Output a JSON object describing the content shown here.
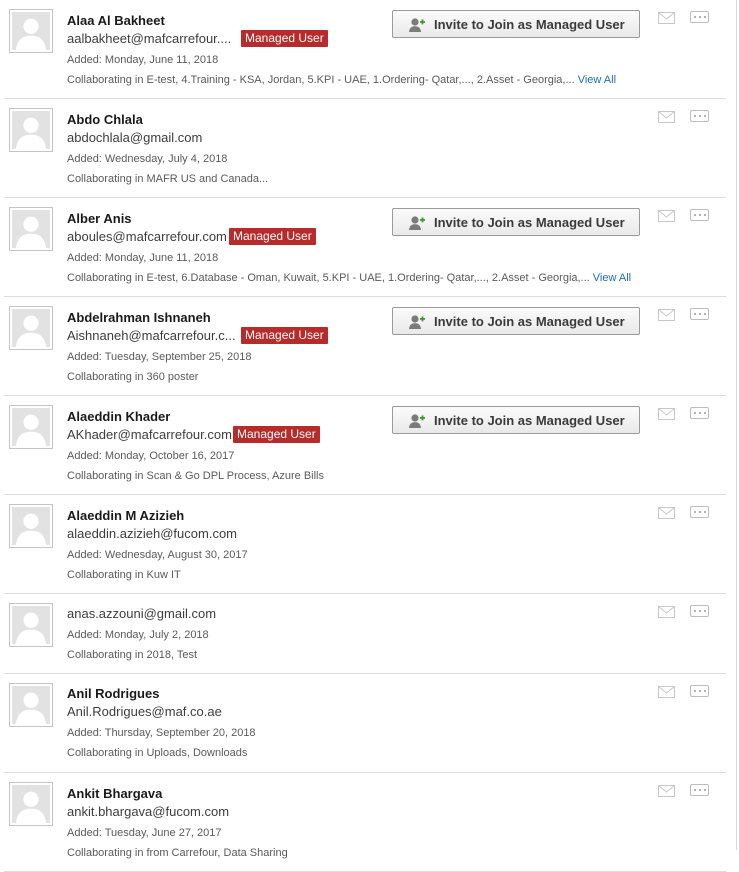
{
  "users": [
    {
      "name": "Alaa Al Bakheet",
      "email": "aalbakheet@mafcarrefour....",
      "managed_badge": "Managed User",
      "added": "Added: Monday, June 11, 2018",
      "collab": "Collaborating in E-test,  4.Training - KSA, Jordan,  5.KPI - UAE,  1.Ordering- Qatar,...,  2.Asset - Georgia,...",
      "view_all": "View All",
      "invite_label": "Invite to Join as Managed User"
    },
    {
      "name": "Abdo Chlala",
      "email": "abdochlala@gmail.com",
      "added": "Added: Wednesday, July 4, 2018",
      "collab": "Collaborating in MAFR US and Canada..."
    },
    {
      "name": "Alber Anis",
      "email": "aboules@mafcarrefour.com",
      "managed_badge": "Managed User",
      "added": "Added: Monday, June 11, 2018",
      "collab": "Collaborating in E-test,  6.Database - Oman, Kuwait,  5.KPI - UAE,  1.Ordering- Qatar,...,  2.Asset - Georgia,...",
      "view_all": "View All",
      "invite_label": "Invite to Join as Managed User"
    },
    {
      "name": "Abdelrahman Ishnaneh",
      "email": "Aishnaneh@mafcarrefour.c...",
      "managed_badge": "Managed User",
      "added": "Added: Tuesday, September 25, 2018",
      "collab": "Collaborating in 360 poster",
      "invite_label": "Invite to Join as Managed User"
    },
    {
      "name": "Alaeddin Khader",
      "email": "AKhader@mafcarrefour.com",
      "managed_badge": "Managed User",
      "added": "Added: Monday, October 16, 2017",
      "collab": "Collaborating in Scan & Go DPL Process,  Azure Bills",
      "invite_label": "Invite to Join as Managed User"
    },
    {
      "name": "Alaeddin M Azizieh",
      "email": "alaeddin.azizieh@fucom.com",
      "added": "Added: Wednesday, August 30, 2017",
      "collab": "Collaborating in Kuw IT"
    },
    {
      "email": "anas.azzouni@gmail.com",
      "added": "Added: Monday, July 2, 2018",
      "collab": "Collaborating in 2018,  Test"
    },
    {
      "name": "Anil Rodrigues",
      "email": "Anil.Rodrigues@maf.co.ae",
      "added": "Added: Thursday, September 20, 2018",
      "collab": "Collaborating in Uploads,  Downloads"
    },
    {
      "name": "Ankit Bhargava",
      "email": "ankit.bhargava@fucom.com",
      "added": "Added: Tuesday, June 27, 2017",
      "collab": "Collaborating in from Carrefour,  Data Sharing"
    }
  ],
  "icons": {
    "avatar": "default-user-avatar-icon",
    "invite": "add-user-icon",
    "mail": "envelope-icon",
    "more": "more-options-icon"
  },
  "colors": {
    "badge": "#b72b2b",
    "link": "#1d6fb8",
    "divider": "#dcdcdc"
  }
}
